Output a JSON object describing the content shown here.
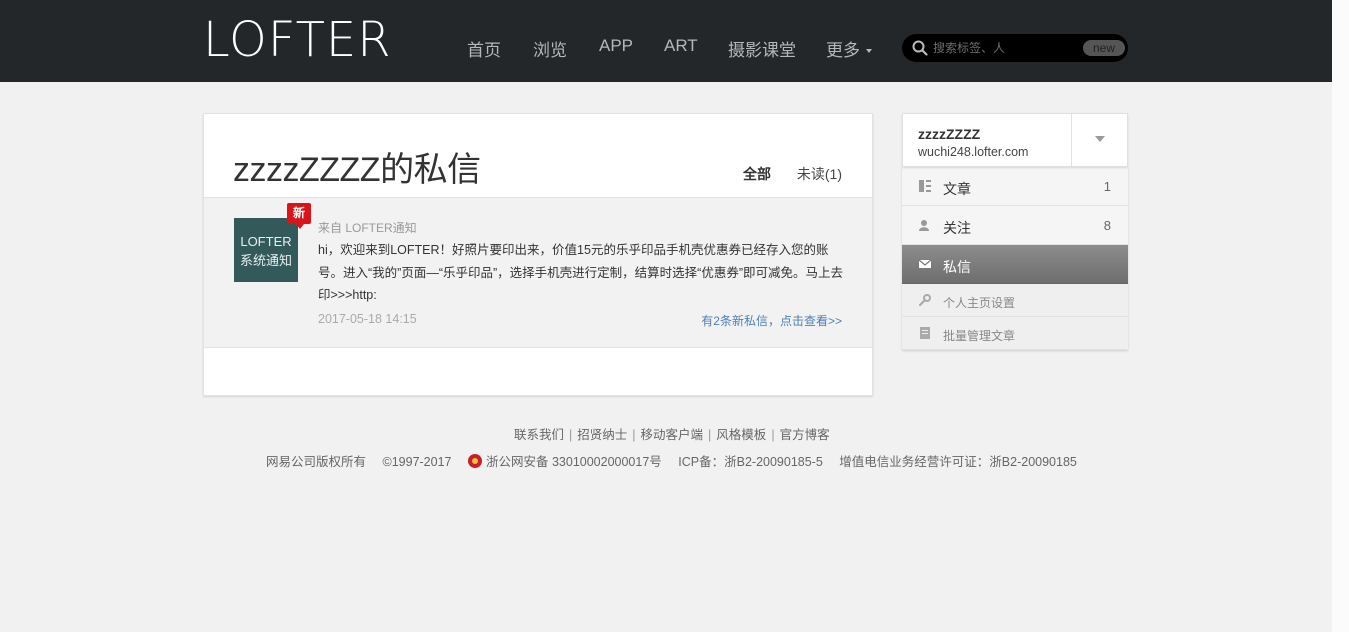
{
  "header": {
    "logo_text": "LOFTER",
    "nav": [
      {
        "label": "首页"
      },
      {
        "label": "浏览"
      },
      {
        "label": "APP"
      },
      {
        "label": "ART"
      },
      {
        "label": "摄影课堂"
      },
      {
        "label": "更多"
      }
    ],
    "search": {
      "placeholder": "搜索标签、人",
      "badge": "new"
    }
  },
  "main": {
    "title": "zzzzZZZZ的私信",
    "tabs": [
      {
        "label": "全部",
        "active": true
      },
      {
        "label": "未读(1)",
        "active": false
      }
    ],
    "message": {
      "avatar_line1": "LOFTER",
      "avatar_line2": "系统通知",
      "new_tag": "新",
      "from": "来自 LOFTER通知",
      "body": "hi，欢迎来到LOFTER！好照片要印出来，价值15元的乐乎印品手机壳优惠券已经存入您的账号。进入“我的”页面—“乐乎印品”，选择手机壳进行定制，结算时选择“优惠券”即可减免。马上去印>>>http:",
      "time": "2017-05-18 14:15",
      "more_link": "有2条新私信，点击查看>>"
    }
  },
  "sidebar": {
    "name": "zzzzZZZZ",
    "domain": "wuchi248.lofter.com",
    "items": [
      {
        "label": "文章",
        "count": "1",
        "icon": "article-icon"
      },
      {
        "label": "关注",
        "count": "8",
        "icon": "follow-icon"
      },
      {
        "label": "私信",
        "count": "",
        "icon": "mail-icon",
        "active": true
      },
      {
        "label": "个人主页设置",
        "count": "",
        "icon": "wrench-icon"
      },
      {
        "label": "批量管理文章",
        "count": "",
        "icon": "document-icon"
      }
    ]
  },
  "footer": {
    "links": [
      "联系我们",
      "招贤纳士",
      "移动客户端",
      "风格模板",
      "官方博客"
    ],
    "copyright": "网易公司版权所有",
    "years": "©1997-2017",
    "police": "浙公网安备 33010002000017号",
    "icp": "ICP备：浙B2-20090185-5",
    "license": "增值电信业务经营许可证：浙B2-20090185"
  },
  "colors": {
    "topbar": "#232729",
    "avatar_bg": "#34595b",
    "new_tag": "#d9141b",
    "link": "#4d80b4"
  }
}
